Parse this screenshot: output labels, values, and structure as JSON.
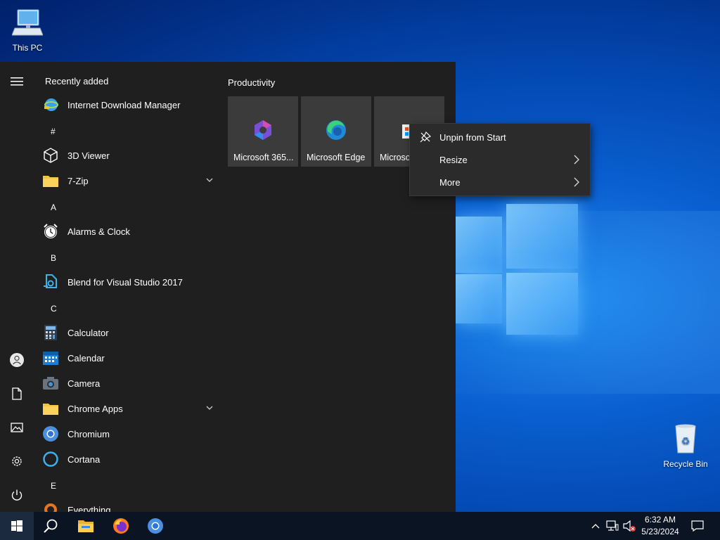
{
  "desktop": {
    "icons": [
      {
        "label": "This PC"
      },
      {
        "label": "Recycle Bin"
      }
    ]
  },
  "start_menu": {
    "recently_added_label": "Recently added",
    "apps": [
      {
        "name": "Internet Download Manager"
      },
      {
        "letter": "#"
      },
      {
        "name": "3D Viewer"
      },
      {
        "name": "7-Zip",
        "expandable": true
      },
      {
        "letter": "A"
      },
      {
        "name": "Alarms & Clock"
      },
      {
        "letter": "B"
      },
      {
        "name": "Blend for Visual Studio 2017"
      },
      {
        "letter": "C"
      },
      {
        "name": "Calculator"
      },
      {
        "name": "Calendar"
      },
      {
        "name": "Camera"
      },
      {
        "name": "Chrome Apps",
        "expandable": true
      },
      {
        "name": "Chromium"
      },
      {
        "name": "Cortana"
      },
      {
        "letter": "E"
      },
      {
        "name": "Everything"
      }
    ],
    "group_title": "Productivity",
    "tiles": [
      {
        "label": "Microsoft 365..."
      },
      {
        "label": "Microsoft Edge"
      },
      {
        "label": "Microso"
      }
    ],
    "rail_icons": [
      "hamburger-icon",
      "user-icon",
      "documents-icon",
      "pictures-icon",
      "settings-icon",
      "power-icon"
    ]
  },
  "context_menu": {
    "items": [
      {
        "label": "Unpin from Start",
        "icon": "unpin-icon"
      },
      {
        "label": "Resize",
        "submenu": true
      },
      {
        "label": "More",
        "submenu": true
      }
    ]
  },
  "taskbar": {
    "time": "6:32 AM",
    "date": "5/23/2024",
    "pinned": [
      "search-icon",
      "file-explorer-icon",
      "firefox-icon",
      "chromium-icon"
    ]
  },
  "colors": {
    "start_bg": "#1f1f1f",
    "tile_bg": "#3b3b3b",
    "taskbar_bg": "#0b1422",
    "context_bg": "#2b2b2b"
  }
}
